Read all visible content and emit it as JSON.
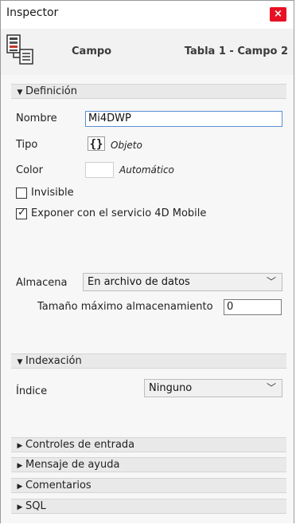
{
  "window": {
    "title": "Inspector",
    "close_label": "×"
  },
  "header": {
    "object_type": "Campo",
    "object_path": "Tabla 1 - Campo 2"
  },
  "definicion": {
    "header": "Definición",
    "nombre_label": "Nombre",
    "nombre_value": "Mi4DWP",
    "tipo_label": "Tipo",
    "tipo_glyph": "{}",
    "tipo_value": "Objeto",
    "color_label": "Color",
    "color_value": "Automático",
    "invisible_label": "Invisible",
    "invisible_checked": false,
    "exponer_label": "Exponer con el servicio 4D Mobile",
    "exponer_checked": true,
    "almacena_label": "Almacena",
    "almacena_value": "En archivo de datos",
    "tamano_label": "Tamaño máximo almacenamiento",
    "tamano_value": "0"
  },
  "indexacion": {
    "header": "Indexación",
    "indice_label": "Índice",
    "indice_value": "Ninguno"
  },
  "collapsed_sections": [
    "Controles de entrada",
    "Mensaje de ayuda",
    "Comentarios",
    "SQL"
  ],
  "colors": {
    "close_button": "#e81123",
    "focus_border": "#5a8fd4",
    "section_bg": "#e9e9e9"
  },
  "icons": {
    "expanded": "triangle-down",
    "collapsed": "triangle-right",
    "field": "field-database-icon",
    "dropdown": "chevron-down"
  }
}
